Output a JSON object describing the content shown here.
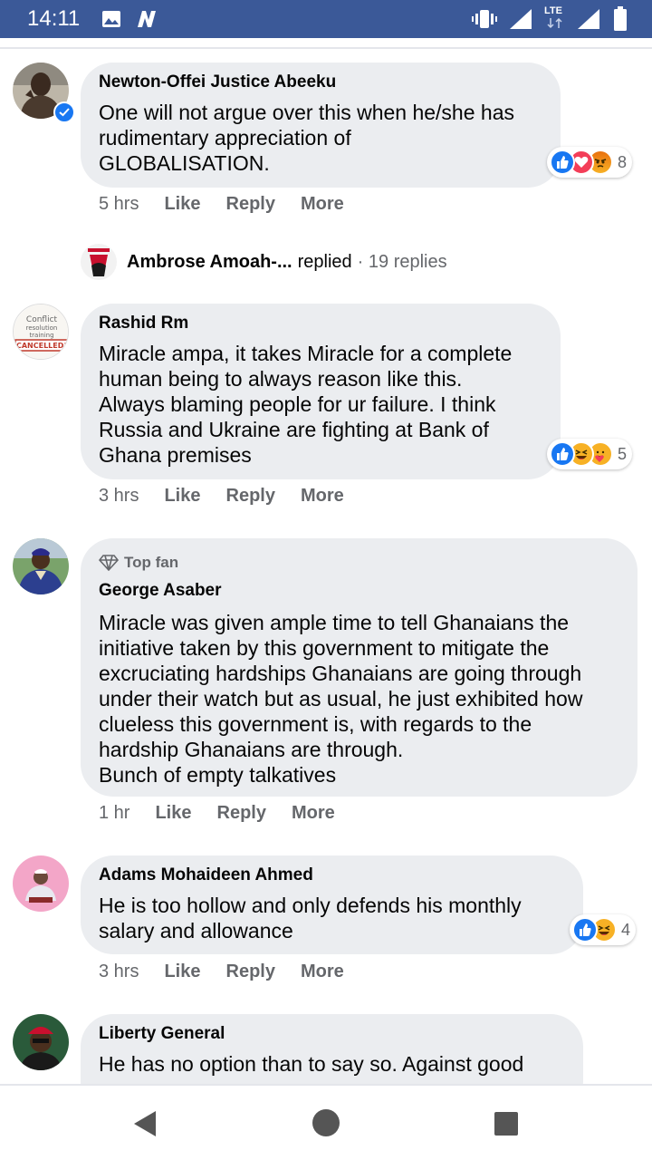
{
  "status_bar": {
    "time": "14:11",
    "network_label": "LTE"
  },
  "comments": [
    {
      "author": "Newton-Offei Justice Abeeku",
      "text": "One will not argue over this when he/she has\nrudimentary appreciation of\nGLOBALISATION.",
      "time": "5 hrs",
      "like": "Like",
      "reply": "Reply",
      "more": "More",
      "reaction_count": "8",
      "reactions": [
        "like-reaction-icon",
        "love-reaction-icon",
        "angry-reaction-icon"
      ],
      "reply_preview": {
        "name": "Ambrose Amoah-...",
        "action": "replied",
        "count": "· 19 replies"
      }
    },
    {
      "author": "Rashid Rm",
      "text": "Miracle ampa, it takes Miracle for a complete\nhuman being to always reason like this.\nAlways blaming people for ur failure. I think\nRussia and Ukraine are fighting at Bank of\nGhana premises",
      "time": "3 hrs",
      "like": "Like",
      "reply": "Reply",
      "more": "More",
      "reaction_count": "5",
      "reactions": [
        "like-reaction-icon",
        "haha-reaction-icon",
        "care-reaction-icon"
      ],
      "avatar_text": [
        "Conflict",
        "resolution",
        "training",
        "CANCELLED!"
      ]
    },
    {
      "badge": "Top fan",
      "author": "George Asaber",
      "text": "Miracle was given ample time to tell Ghanaians the\ninitiative taken by this government to mitigate the\nexcruciating hardships Ghanaians are going through\nunder their watch but as usual, he just exhibited how\nclueless this government is, with regards to the\nhardship Ghanaians are through.\nBunch of empty talkatives",
      "time": "1 hr",
      "like": "Like",
      "reply": "Reply",
      "more": "More"
    },
    {
      "author": "Adams Mohaideen Ahmed",
      "text": "He is too hollow and only defends his monthly\nsalary and allowance",
      "time": "3 hrs",
      "like": "Like",
      "reply": "Reply",
      "more": "More",
      "reaction_count": "4",
      "reactions": [
        "like-reaction-icon",
        "haha-reaction-icon"
      ]
    },
    {
      "author": "Liberty General",
      "text": "He has no option than to say so. Against good"
    }
  ],
  "colors": {
    "status_bar": "#3b5998",
    "bubble": "#ebedf0",
    "like_blue": "#1877f2",
    "love_red": "#f33e58",
    "meta_gray": "#65676b"
  }
}
